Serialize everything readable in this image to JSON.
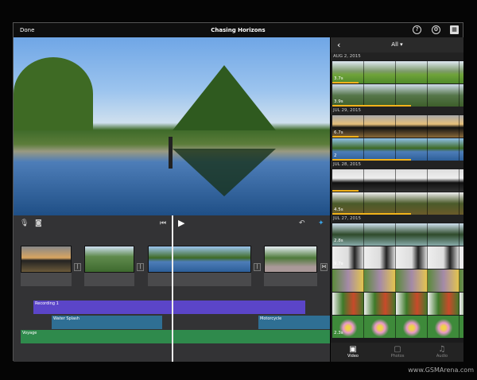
{
  "topbar": {
    "done": "Done",
    "title": "Chasing Horizons",
    "help_icon": "?",
    "settings_icon": "⚙",
    "browser_icon": "▦"
  },
  "browser": {
    "back": "‹",
    "filter": "All ▾",
    "sections": [
      {
        "date": "AUG 2, 2015",
        "clips": [
          {
            "dur": "3.7s"
          },
          {
            "dur": "3.9s"
          }
        ]
      },
      {
        "date": "JUL 29, 2015",
        "clips": [
          {
            "dur": "6.7s"
          },
          {
            "dur": "2"
          }
        ]
      },
      {
        "date": "JUL 28, 2015",
        "clips": [
          {
            "dur": ""
          },
          {
            "dur": "4.5s"
          }
        ]
      },
      {
        "date": "JUL 27, 2015",
        "clips": [
          {
            "dur": "2.8s"
          },
          {
            "dur": "9.7s"
          },
          {
            "dur": ""
          },
          {
            "dur": ""
          },
          {
            "dur": "2.3s"
          }
        ]
      }
    ],
    "tabs": [
      {
        "label": "Video",
        "icon": "▣"
      },
      {
        "label": "Photos",
        "icon": "▢"
      },
      {
        "label": "Audio",
        "icon": "♫"
      }
    ]
  },
  "timeline": {
    "audio": [
      {
        "label": "Recording 1",
        "color": "#5b45c8"
      },
      {
        "label": "Water Splash",
        "color": "#2f6f94"
      },
      {
        "label": "Motorcycle",
        "color": "#2f6f94"
      },
      {
        "label": "Voyage",
        "color": "#2f8a4c"
      }
    ]
  },
  "watermark": "www.GSMArena.com"
}
